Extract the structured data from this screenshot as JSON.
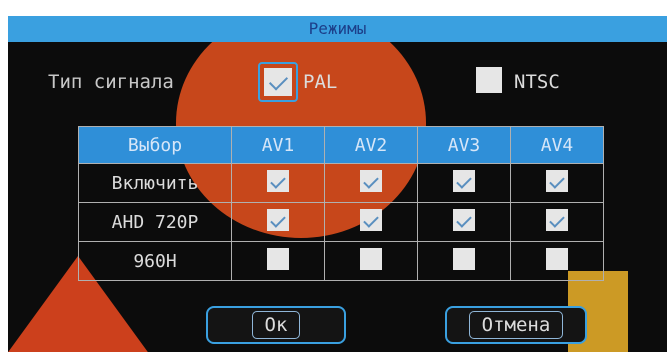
{
  "title": "Режимы",
  "signal": {
    "label": "Тип сигнала",
    "pal": {
      "label": "PAL",
      "checked": true
    },
    "ntsc": {
      "label": "NTSC",
      "checked": false
    }
  },
  "table": {
    "header": [
      "Выбор",
      "AV1",
      "AV2",
      "AV3",
      "AV4"
    ],
    "rows": [
      {
        "label": "Включить",
        "values": [
          true,
          true,
          true,
          true
        ]
      },
      {
        "label": "AHD 720P",
        "values": [
          true,
          true,
          true,
          true
        ]
      },
      {
        "label": "960H",
        "values": [
          false,
          false,
          false,
          false
        ]
      }
    ]
  },
  "buttons": {
    "ok": "Ок",
    "cancel": "Отмена"
  },
  "colors": {
    "accent": "#3aa0e0",
    "header": "#2f8fd8",
    "background": "#0c0c0c"
  }
}
